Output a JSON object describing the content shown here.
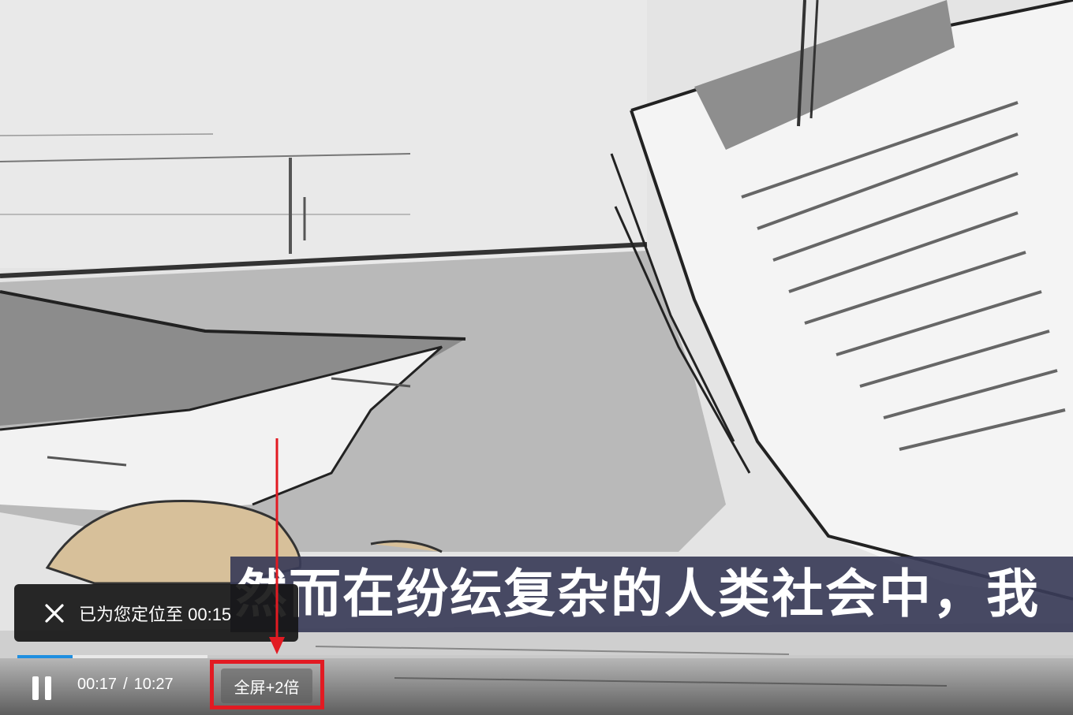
{
  "subtitle": {
    "text": "然而在纷纭复杂的人类社会中，我"
  },
  "toast": {
    "close_icon": "close-icon",
    "text": "已为您定位至 00:15"
  },
  "player": {
    "progress": {
      "played_fraction": 0.052,
      "buffered_fraction": 0.18
    },
    "controls": {
      "pause_icon": "pause-icon",
      "current_time": "00:17",
      "separator": "/",
      "duration": "10:27",
      "fullscreen_label": "全屏+2倍"
    }
  },
  "colors": {
    "progress": "#1f8fe0",
    "annotation": "#e21a22",
    "subtitle_band": "#3a3c58"
  }
}
